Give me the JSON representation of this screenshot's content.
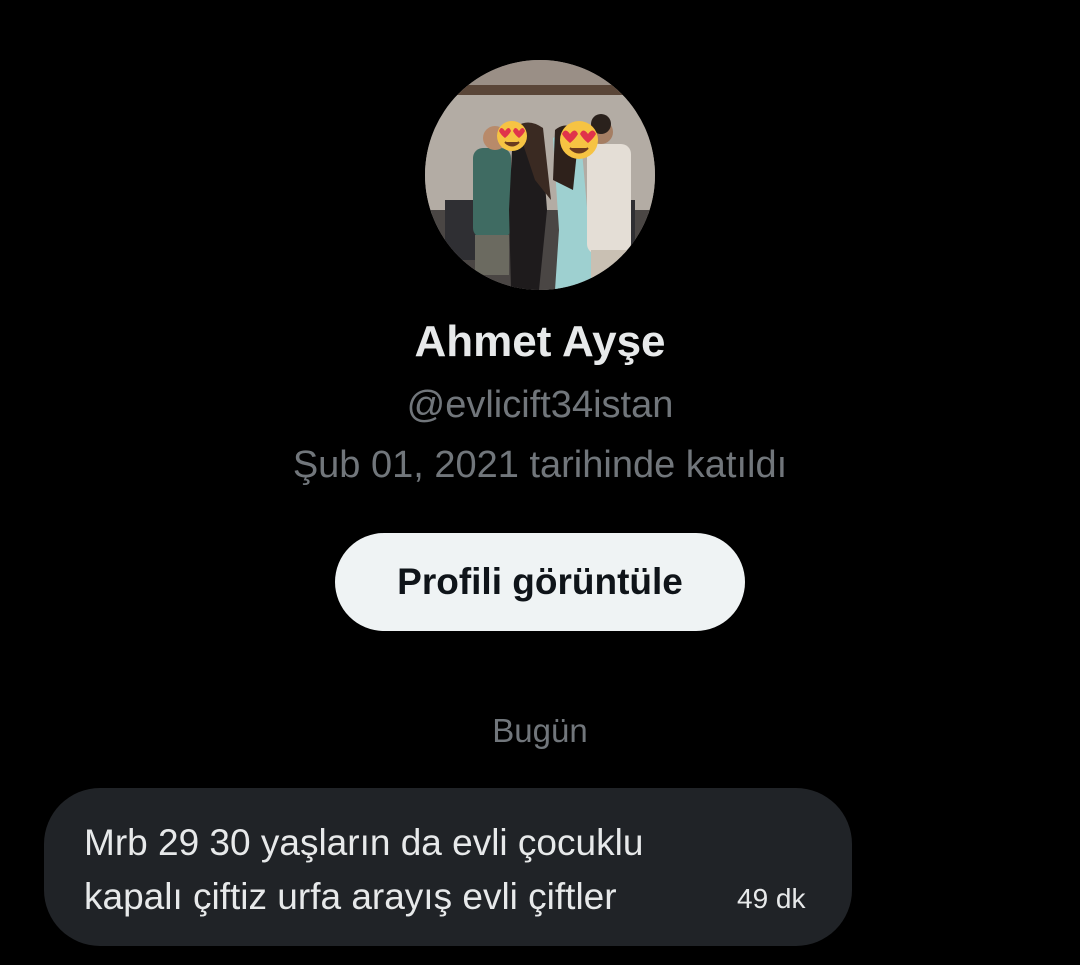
{
  "profile": {
    "display_name": "Ahmet Ayşe",
    "handle": "@evlicift34istan",
    "joined": "Şub 01, 2021 tarihinde katıldı",
    "view_profile_label": "Profili görüntüle"
  },
  "conversation": {
    "day_label": "Bugün",
    "messages": [
      {
        "line1": "Mrb 29 30 yaşların da evli çocuklu",
        "line2": "kapalı çiftiz urfa arayış evli çiftler",
        "time": "49 dk"
      }
    ]
  },
  "colors": {
    "background": "#000000",
    "primary_text": "#e7e9ea",
    "secondary_text": "#71767b",
    "button_bg": "#eff3f4",
    "bubble_bg": "#202327"
  },
  "icons": {
    "avatar_emoji_overlays": [
      "heart-eyes-emoji",
      "heart-eyes-emoji"
    ]
  }
}
